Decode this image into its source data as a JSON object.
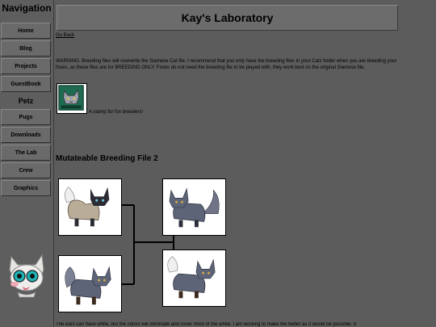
{
  "sidebar": {
    "title": "Navigation",
    "items": [
      {
        "label": "Home"
      },
      {
        "label": "Blog"
      },
      {
        "label": "Projects"
      },
      {
        "label": "GuestBook"
      }
    ],
    "section": "Petz",
    "subitems": [
      {
        "label": "Pugs"
      },
      {
        "label": "Downloads"
      },
      {
        "label": "The Lab"
      },
      {
        "label": "Crew"
      },
      {
        "label": "Graphics"
      }
    ]
  },
  "header": {
    "title": "Kay's Laboratory"
  },
  "main": {
    "go_back": "Go Back",
    "warning": "WARNING: Breeding files will overwrite the Siamese Cat file. I recommend that you only have the breeding files in your Catz folder when you are breeding your foxes, as these files are for BREEDING ONLY. Foxes do not need the breeding file to be played with, they work best on the original Siamese file.",
    "stamp_caption": "A stamp for fox breeders!",
    "section_heading": "Mutateable Breeding File 2",
    "footer_text": "The ears can have white, but the colors will dominate and cover most of the white. I am working to make the better as it would be possible. It"
  },
  "colors": {
    "background": "#5c5c5c",
    "panel": "#6c6c6c",
    "fox_grey": "#5d6478",
    "fox_tan": "#b9ad98"
  }
}
